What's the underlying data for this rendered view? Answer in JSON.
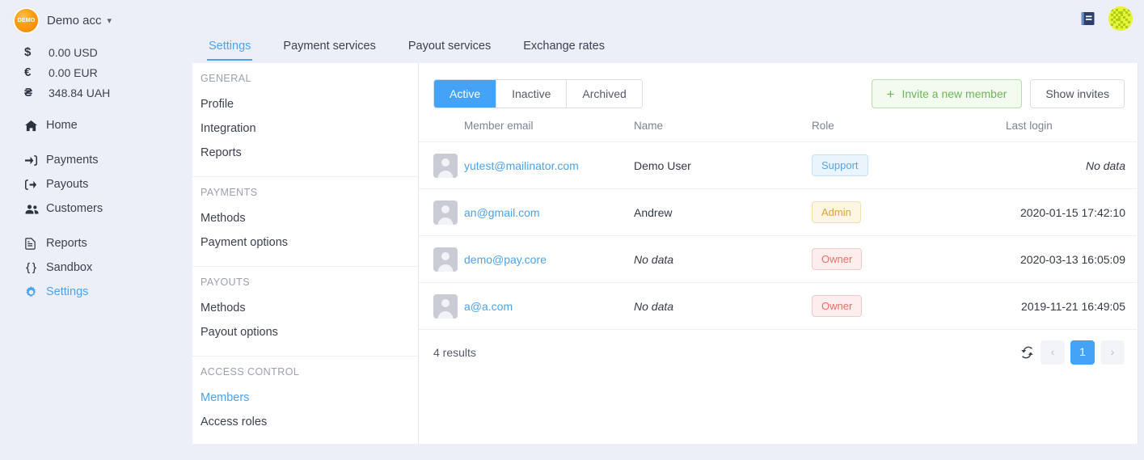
{
  "account": {
    "badge_text": "DEMO",
    "name": "Demo acc",
    "caret_icon": "chevron-down-icon"
  },
  "balances": [
    {
      "symbol": "$",
      "amount": "0.00 USD"
    },
    {
      "symbol": "€",
      "amount": "0.00 EUR"
    },
    {
      "symbol": "₴",
      "amount": "348.84 UAH"
    }
  ],
  "sidebar": {
    "groups": [
      {
        "items": [
          {
            "label": "Home",
            "icon": "home-icon",
            "active": false
          }
        ]
      },
      {
        "items": [
          {
            "label": "Payments",
            "icon": "payments-arrow-in-icon",
            "active": false
          },
          {
            "label": "Payouts",
            "icon": "payouts-arrow-out-icon",
            "active": false
          },
          {
            "label": "Customers",
            "icon": "customers-people-icon",
            "active": false
          }
        ]
      },
      {
        "items": [
          {
            "label": "Reports",
            "icon": "reports-document-icon",
            "active": false
          },
          {
            "label": "Sandbox",
            "icon": "sandbox-braces-icon",
            "active": false
          },
          {
            "label": "Settings",
            "icon": "settings-gear-icon",
            "active": true
          }
        ]
      }
    ]
  },
  "topbar": {
    "book_icon": "documentation-book-icon",
    "avatar_icon": "user-identicon-avatar"
  },
  "tabs": [
    {
      "label": "Settings",
      "active": true
    },
    {
      "label": "Payment services",
      "active": false
    },
    {
      "label": "Payout services",
      "active": false
    },
    {
      "label": "Exchange rates",
      "active": false
    }
  ],
  "subnav": [
    {
      "title": "GENERAL",
      "items": [
        {
          "label": "Profile",
          "active": false
        },
        {
          "label": "Integration",
          "active": false
        },
        {
          "label": "Reports",
          "active": false
        }
      ]
    },
    {
      "title": "PAYMENTS",
      "items": [
        {
          "label": "Methods",
          "active": false
        },
        {
          "label": "Payment options",
          "active": false
        }
      ]
    },
    {
      "title": "PAYOUTS",
      "items": [
        {
          "label": "Methods",
          "active": false
        },
        {
          "label": "Payout options",
          "active": false
        }
      ]
    },
    {
      "title": "ACCESS CONTROL",
      "items": [
        {
          "label": "Members",
          "active": true
        },
        {
          "label": "Access roles",
          "active": false
        }
      ]
    }
  ],
  "filters": [
    {
      "label": "Active",
      "active": true
    },
    {
      "label": "Inactive",
      "active": false
    },
    {
      "label": "Archived",
      "active": false
    }
  ],
  "actions": {
    "invite_label": "Invite a new member",
    "invite_plus": "+",
    "show_invites_label": "Show invites"
  },
  "table": {
    "columns": {
      "email": "Member email",
      "name": "Name",
      "role": "Role",
      "last_login": "Last login"
    },
    "rows": [
      {
        "email": "yutest@mailinator.com",
        "name": "Demo User",
        "name_empty": false,
        "role": "Support",
        "role_kind": "support",
        "last_login": "No data",
        "login_empty": true
      },
      {
        "email": "an@gmail.com",
        "name": "Andrew",
        "name_empty": false,
        "role": "Admin",
        "role_kind": "admin",
        "last_login": "2020-01-15 17:42:10",
        "login_empty": false
      },
      {
        "email": "demo@pay.core",
        "name": "No data",
        "name_empty": true,
        "role": "Owner",
        "role_kind": "owner",
        "last_login": "2020-03-13 16:05:09",
        "login_empty": false
      },
      {
        "email": "a@a.com",
        "name": "No data",
        "name_empty": true,
        "role": "Owner",
        "role_kind": "owner",
        "last_login": "2019-11-21 16:49:05",
        "login_empty": false
      }
    ]
  },
  "footer": {
    "results": "4 results",
    "refresh_icon": "refresh-icon",
    "prev_label": "‹",
    "next_label": "›",
    "pages": [
      "1"
    ],
    "current_page": "1"
  },
  "colors": {
    "accent": "#44a3f7",
    "link": "#4aa3f0",
    "page_bg": "#eceff8",
    "panel_bg": "#ffffff",
    "green": "#6cb753",
    "owner": "#ef6b6b",
    "admin": "#e0a62b"
  }
}
